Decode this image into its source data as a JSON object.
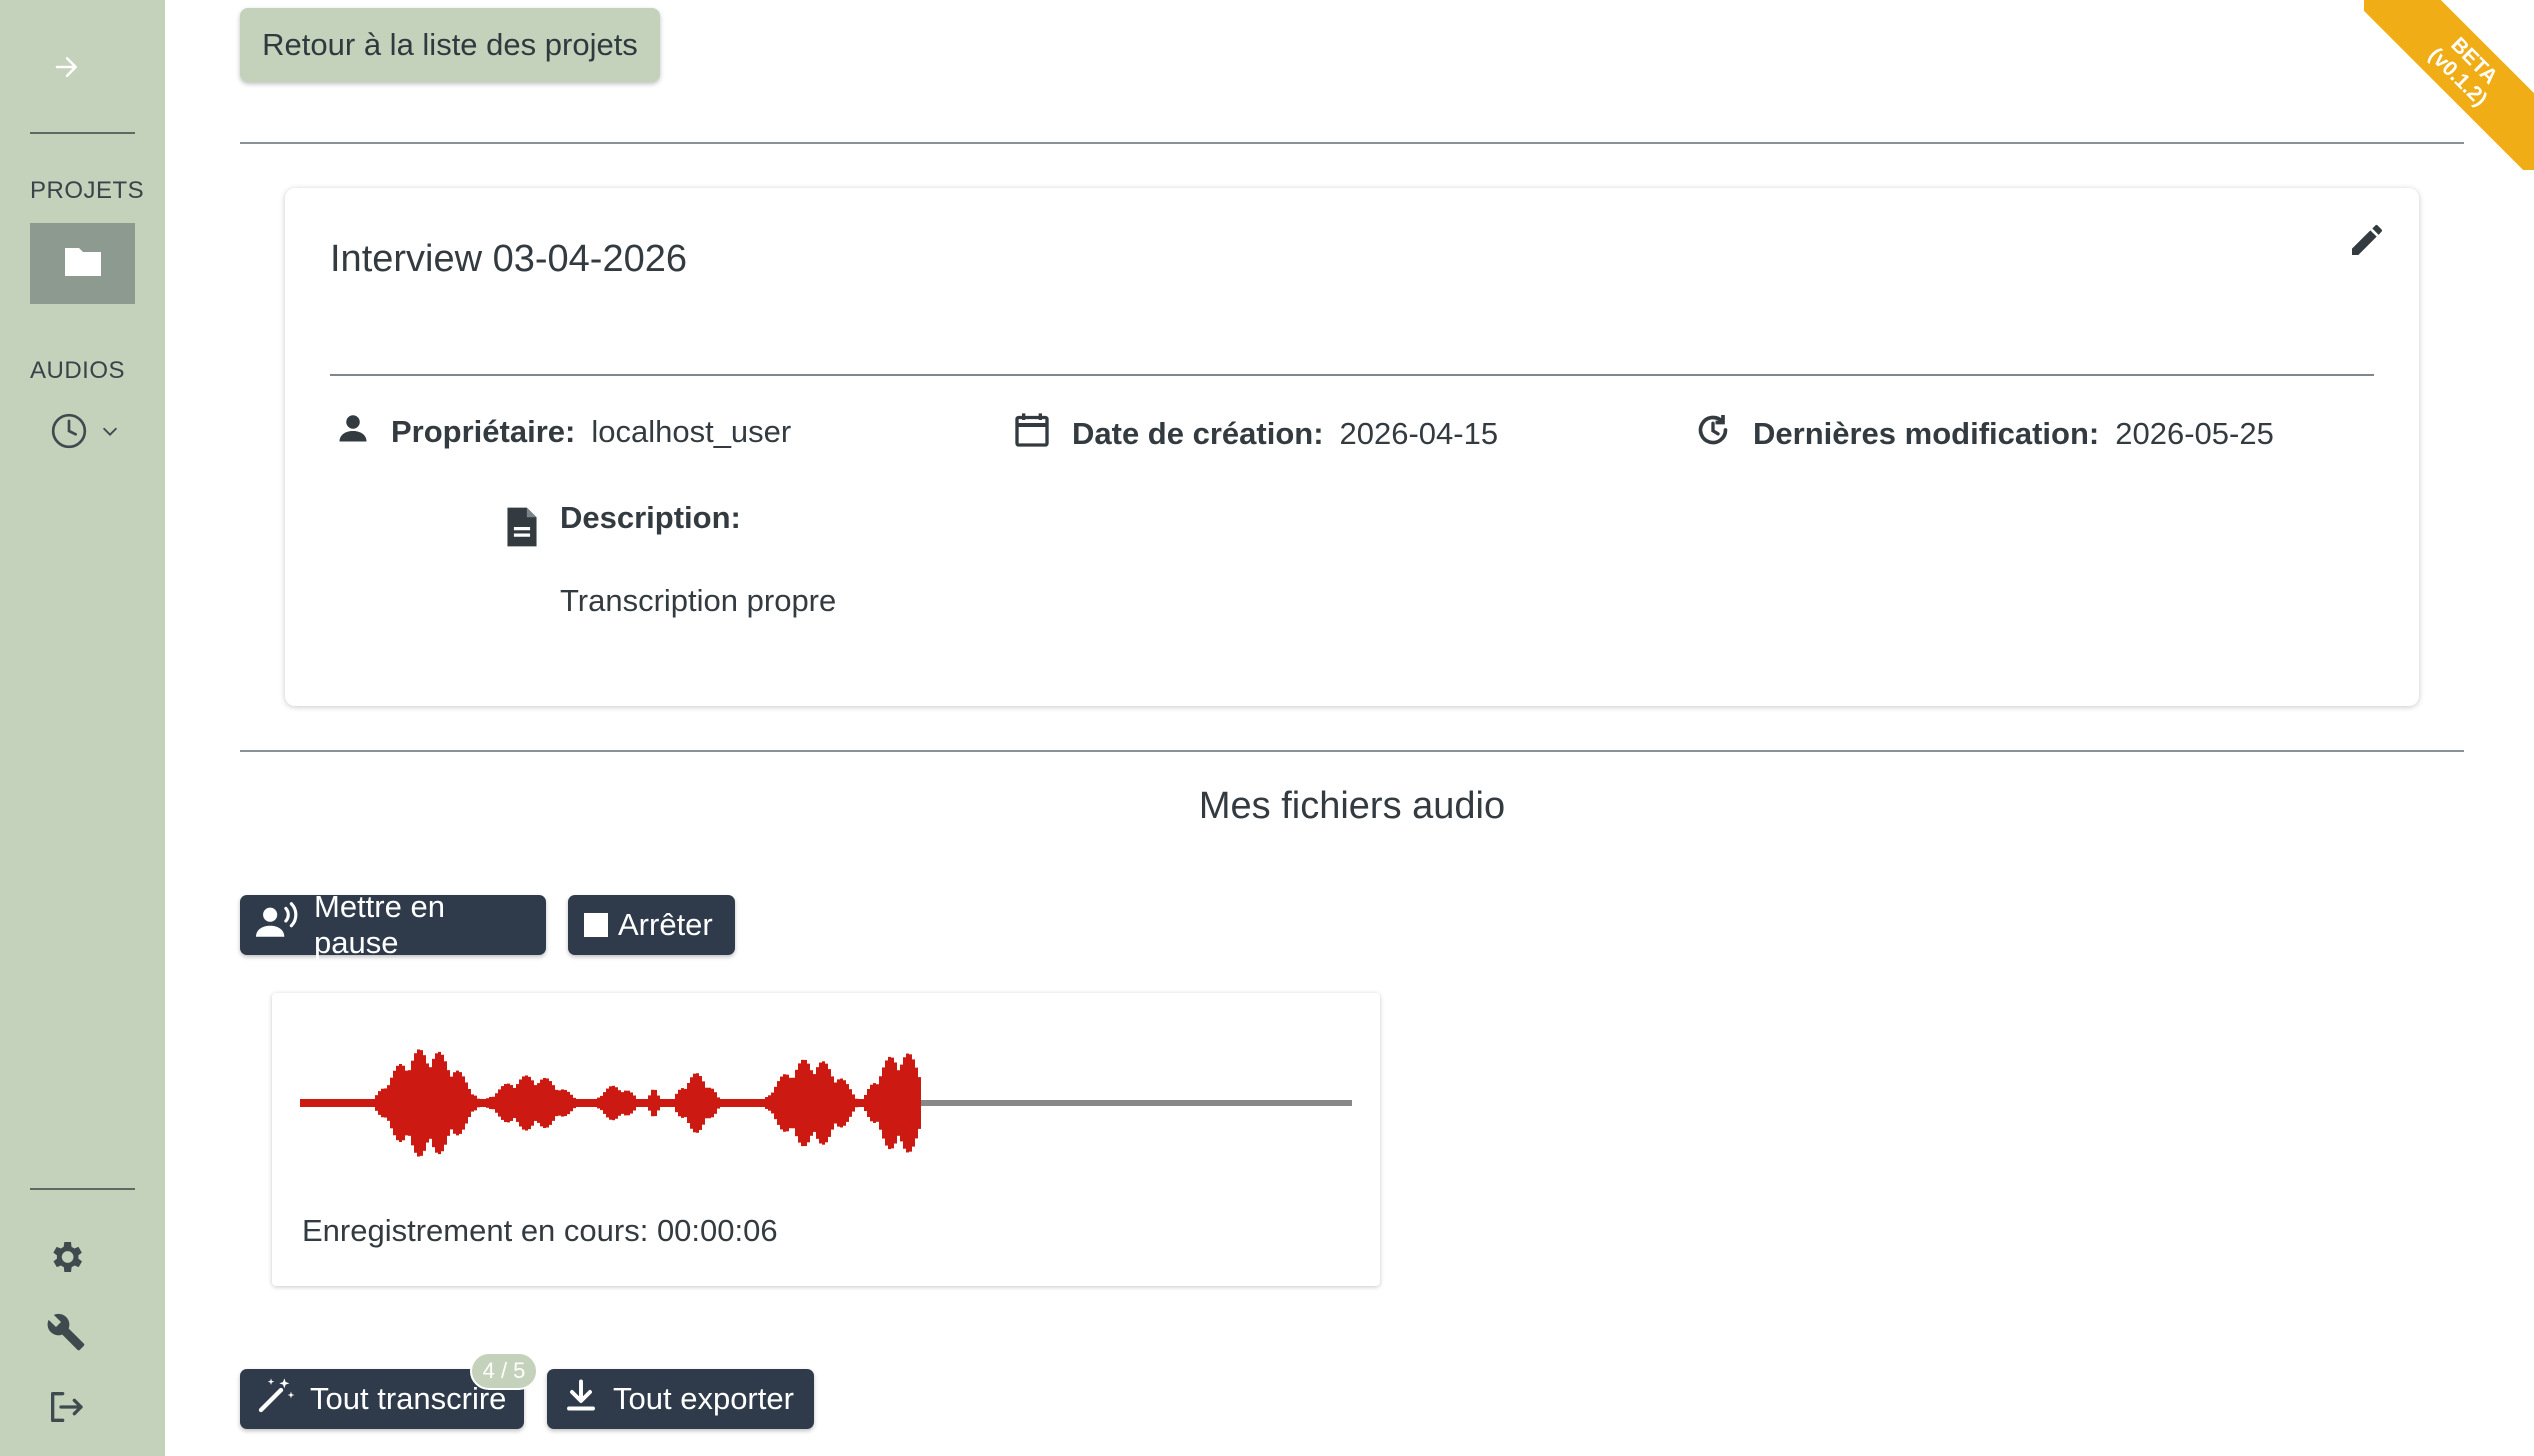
{
  "sidebar": {
    "expand_icon": "arrow-right-icon",
    "projects_label": "PROJETS",
    "projects_icon": "folder-icon",
    "audios_label": "AUDIOS",
    "audios_icon": "clock-icon",
    "audios_toggle_icon": "chevron-down-icon",
    "bottom_icons": [
      "gear-icon",
      "wrench-icon",
      "logout-icon"
    ]
  },
  "ribbon": {
    "line1": "BETA",
    "line2": "(v0.1.2)"
  },
  "header": {
    "back_label": "Retour à la liste des projets"
  },
  "project": {
    "title": "Interview 03-04-2026",
    "owner_label": "Propriétaire:",
    "owner_value": "localhost_user",
    "created_label": "Date de création:",
    "created_value": "2026-04-15",
    "modified_label": "Dernières modification:",
    "modified_value": "2026-05-25",
    "description_label": "Description:",
    "description_value": "Transcription propre"
  },
  "audio_section": {
    "title": "Mes fichiers audio",
    "pause_label": "Mettre en pause",
    "stop_label": "Arrêter",
    "recording_status": "Enregistrement en cours: 00:00:06",
    "recorded_fraction": 0.59
  },
  "actions": {
    "transcribe_label": "Tout transcrire",
    "transcribe_badge": "4 / 5",
    "export_label": "Tout exporter"
  },
  "colors": {
    "sidebar": "#c4d1bb",
    "dark_button": "#2f3b4b",
    "wave_recorded": "#cc1a12",
    "wave_remaining": "#888888",
    "ribbon": "#f0ad15"
  }
}
